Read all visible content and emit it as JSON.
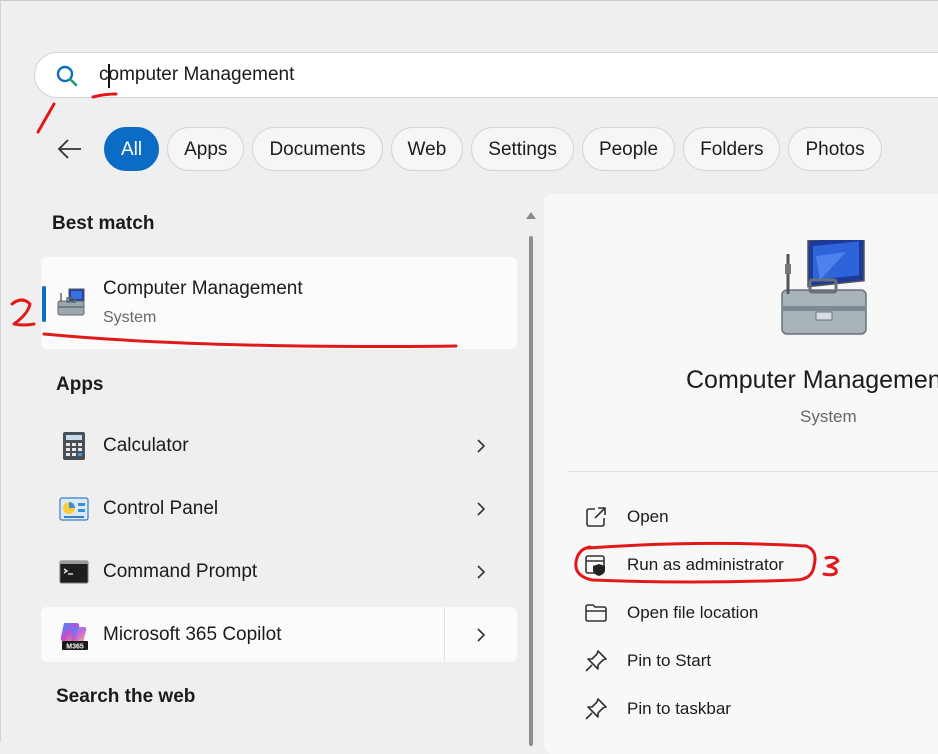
{
  "search": {
    "value": "computer Management",
    "placeholder": ""
  },
  "filters": [
    "All",
    "Apps",
    "Documents",
    "Web",
    "Settings",
    "People",
    "Folders",
    "Photos"
  ],
  "best_match": {
    "heading": "Best match",
    "title": "Computer Management",
    "subtitle": "System"
  },
  "apps": {
    "heading": "Apps",
    "items": [
      {
        "label": "Calculator",
        "icon": "calculator-icon"
      },
      {
        "label": "Control Panel",
        "icon": "control-panel-icon"
      },
      {
        "label": "Command Prompt",
        "icon": "command-prompt-icon"
      },
      {
        "label": "Microsoft 365 Copilot",
        "icon": "m365-copilot-icon"
      }
    ]
  },
  "search_web": {
    "heading": "Search the web"
  },
  "detail": {
    "title": "Computer Management",
    "subtitle": "System",
    "actions": [
      {
        "label": "Open",
        "icon": "open-external-icon"
      },
      {
        "label": "Run as administrator",
        "icon": "shield-icon"
      },
      {
        "label": "Open file location",
        "icon": "folder-icon"
      },
      {
        "label": "Pin to Start",
        "icon": "pin-icon"
      },
      {
        "label": "Pin to taskbar",
        "icon": "pin-icon"
      }
    ]
  },
  "colors": {
    "accent": "#0a6cc4",
    "annotation": "#e01a1a"
  }
}
